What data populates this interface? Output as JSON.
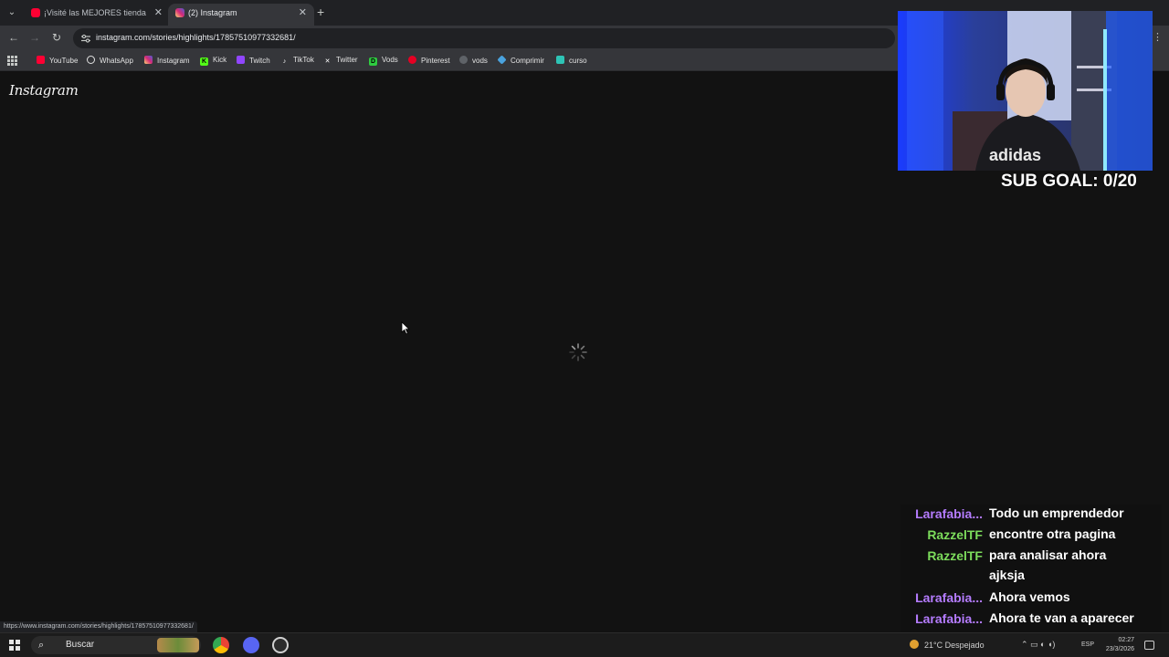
{
  "browser": {
    "tabs": [
      {
        "title": "¡Visité las MEJORES tiendas de I",
        "active": false,
        "favicon": "youtube-icon",
        "favicon_color": "#ff0033"
      },
      {
        "title": "(2) Instagram",
        "active": true,
        "favicon": "instagram-icon",
        "favicon_color": "#d62976"
      }
    ],
    "url": "instagram.com/stories/highlights/17857510977332681/",
    "bookmarks": [
      {
        "label": "YouTube",
        "icon": "youtube-icon",
        "color": "#ff0033"
      },
      {
        "label": "WhatsApp",
        "icon": "whatsapp-icon",
        "color": "#25d366"
      },
      {
        "label": "Instagram",
        "icon": "instagram-icon",
        "color": "#d62976"
      },
      {
        "label": "Kick",
        "icon": "kick-icon",
        "color": "#53fc18"
      },
      {
        "label": "Twitch",
        "icon": "twitch-icon",
        "color": "#9146ff"
      },
      {
        "label": "TikTok",
        "icon": "tiktok-icon",
        "color": "#ffffff"
      },
      {
        "label": "Twitter",
        "icon": "x-icon",
        "color": "#ffffff"
      },
      {
        "label": "Vods",
        "icon": "vods-icon",
        "color": "#2ecc40"
      },
      {
        "label": "Pinterest",
        "icon": "pinterest-icon",
        "color": "#e60023"
      },
      {
        "label": "vods",
        "icon": "vods-alt-icon",
        "color": "#9aa0a6"
      },
      {
        "label": "Comprimir",
        "icon": "diamond-icon",
        "color": "#4aa3df"
      },
      {
        "label": "curso",
        "icon": "folder-icon",
        "color": "#2ec4b6"
      }
    ],
    "status_url": "https://www.instagram.com/stories/highlights/17857510977332681/"
  },
  "page": {
    "logo": "Instagram"
  },
  "overlay": {
    "sub_goal": "SUB GOAL: 0/20",
    "webcam_shirt_text": "adidas",
    "chat": [
      {
        "user": "Larafabia...",
        "message": "Todo un emprendedor",
        "color": "#b57cff"
      },
      {
        "user": "RazzelTF",
        "message": "encontre otra pagina",
        "color": "#7cdc5c"
      },
      {
        "user": "RazzelTF",
        "message": "para analisar ahora ajksja",
        "color": "#7cdc5c"
      },
      {
        "user": "Larafabia...",
        "message": "Ahora vemos",
        "color": "#b57cff"
      },
      {
        "user": "Larafabia...",
        "message": "Ahora te van a aparecer un montón",
        "color": "#b57cff"
      }
    ]
  },
  "taskbar": {
    "search_label": "Buscar",
    "weather": "21°C  Despejado",
    "language": "ESP",
    "time": "02:27",
    "date": "23/3/2026"
  }
}
